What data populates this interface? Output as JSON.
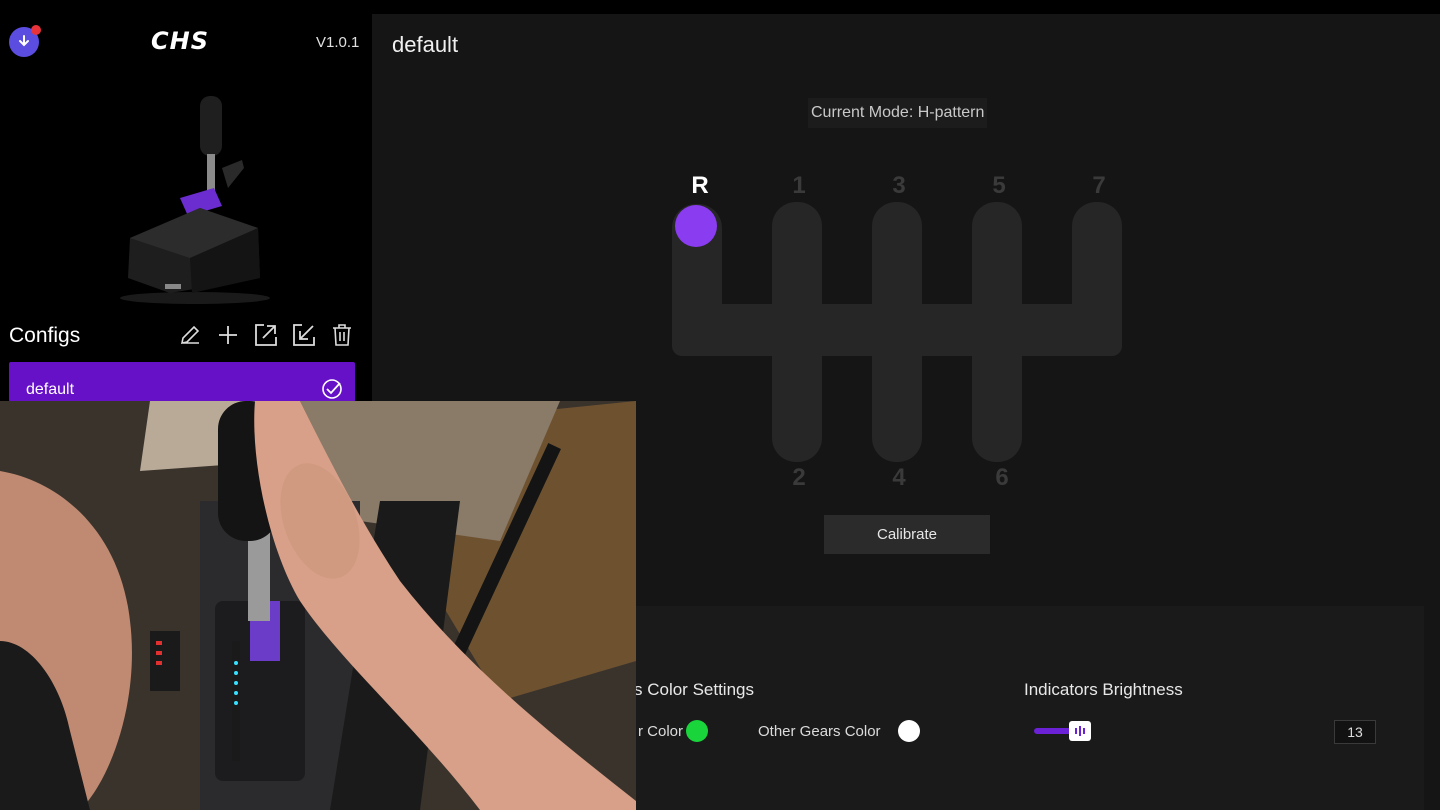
{
  "app": {
    "brand": "CHS",
    "version": "V1.0.1"
  },
  "sidebar": {
    "configs_title": "Configs",
    "tools": [
      {
        "name": "edit",
        "icon": "pencil-icon"
      },
      {
        "name": "add",
        "icon": "plus-icon"
      },
      {
        "name": "export",
        "icon": "export-icon"
      },
      {
        "name": "import",
        "icon": "import-icon"
      },
      {
        "name": "delete",
        "icon": "trash-icon"
      }
    ],
    "configs": [
      {
        "label": "default",
        "selected": true
      }
    ]
  },
  "main": {
    "title": "default",
    "mode_label": "Current Mode: H-pattern",
    "gears_top": [
      "R",
      "1",
      "3",
      "5",
      "7"
    ],
    "gears_bottom": [
      "2",
      "4",
      "6"
    ],
    "active_gear": "R",
    "calibrate_label": "Calibrate",
    "color_settings_title": "s Color Settings",
    "color_a_label": "r Color",
    "color_a": "#19d43a",
    "color_b_label": "Other Gears Color",
    "color_b": "#ffffff",
    "brightness_title": "Indicators Brightness",
    "brightness_value": "13",
    "brightness_fraction": 0.13
  },
  "colors": {
    "accent": "#6610c8",
    "active_gear_dot": "#8a3cf0"
  }
}
